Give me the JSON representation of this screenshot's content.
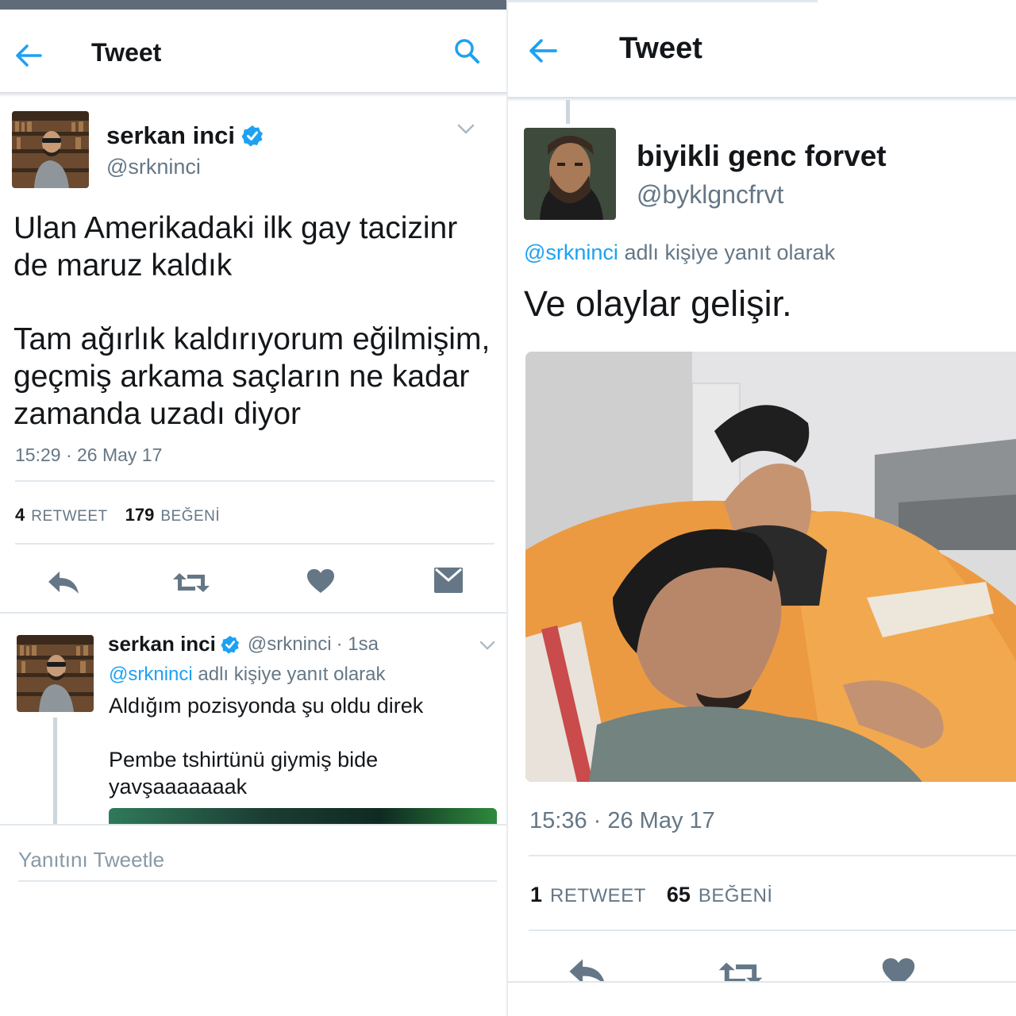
{
  "left": {
    "header": {
      "title": "Tweet"
    },
    "tweet": {
      "author_name": "serkan inci",
      "author_handle": "@srkninci",
      "text_lines": [
        "Ulan Amerikadaki ilk gay tacizinr",
        "de maruz kaldık",
        "Tam ağırlık kaldırıyorum eğilmişim,",
        "geçmiş arkama saçların ne kadar",
        "zamanda uzadı diyor"
      ],
      "timestamp": "15:29 · 26 May 17",
      "retweets": {
        "count": "4",
        "label": "RETWEET"
      },
      "likes": {
        "count": "179",
        "label": "BEĞENİ"
      }
    },
    "reply": {
      "author_name": "serkan inci",
      "author_handle": "@srkninci",
      "age": "· 1sa",
      "reply_to_handle": "@srkninci",
      "reply_to_suffix": "adlı kişiye yanıt olarak",
      "text_lines": [
        "Aldığım pozisyonda şu oldu direk",
        "Pembe tshirtünü giymiş bide",
        "yavşaaaaaaak"
      ]
    },
    "reply_box": {
      "placeholder": "Yanıtını Tweetle"
    }
  },
  "right": {
    "header": {
      "title": "Tweet"
    },
    "tweet": {
      "author_name": "biyikli genc forvet",
      "author_handle": "@byklgncfrvt",
      "reply_to_handle": "@srkninci",
      "reply_to_suffix": "adlı kişiye yanıt olarak",
      "text": "Ve olaylar gelişir.",
      "timestamp": "15:36 · 26 May 17",
      "retweets": {
        "count": "1",
        "label": "RETWEET"
      },
      "likes": {
        "count": "65",
        "label": "BEĞENİ"
      }
    }
  },
  "colors": {
    "accent": "#1da1f2",
    "text": "#14171a",
    "secondary": "#657786",
    "icon": "#657786",
    "divider": "#e1e8ed"
  },
  "icons": [
    "back-arrow-icon",
    "search-icon",
    "verified-badge-icon",
    "chevron-down-icon",
    "reply-icon",
    "retweet-icon",
    "like-icon",
    "direct-message-icon"
  ]
}
